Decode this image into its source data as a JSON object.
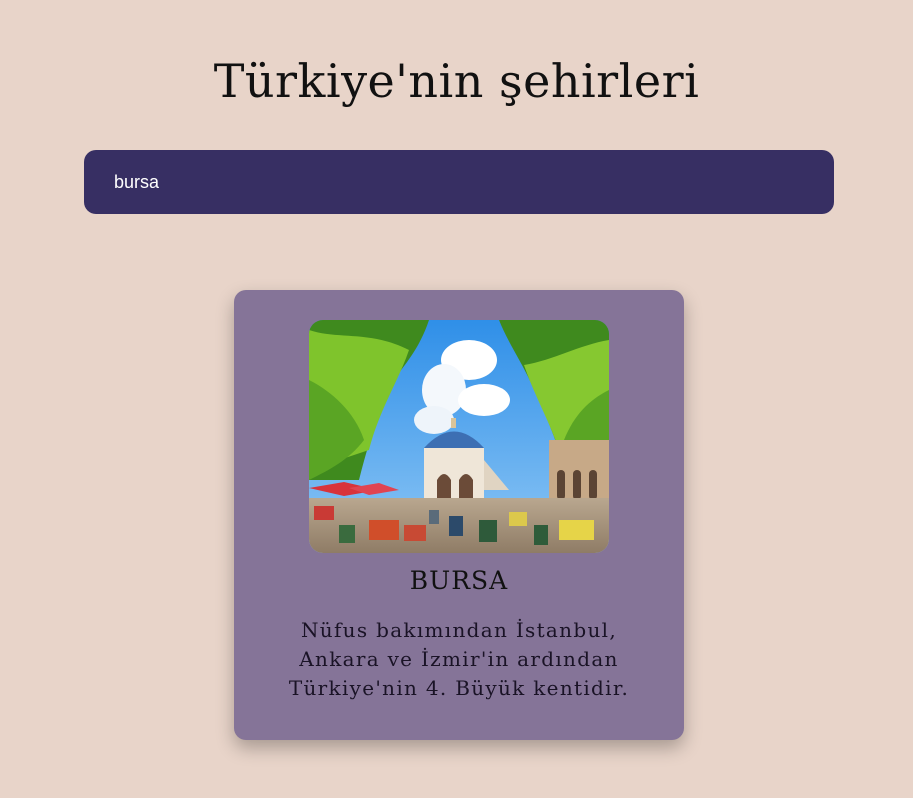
{
  "header": {
    "title": "Türkiye'nin şehirleri"
  },
  "search": {
    "value": "bursa"
  },
  "results": [
    {
      "name": "BURSA",
      "description": "Nüfus bakımından İstanbul, Ankara ve İzmir'in ardından Türkiye'nin 4. Büyük kentidir.",
      "image": "koza-han-courtyard-photo"
    }
  ],
  "colors": {
    "background": "#e8d4c9",
    "search_bg": "#372f63",
    "card_bg": "#857498"
  }
}
